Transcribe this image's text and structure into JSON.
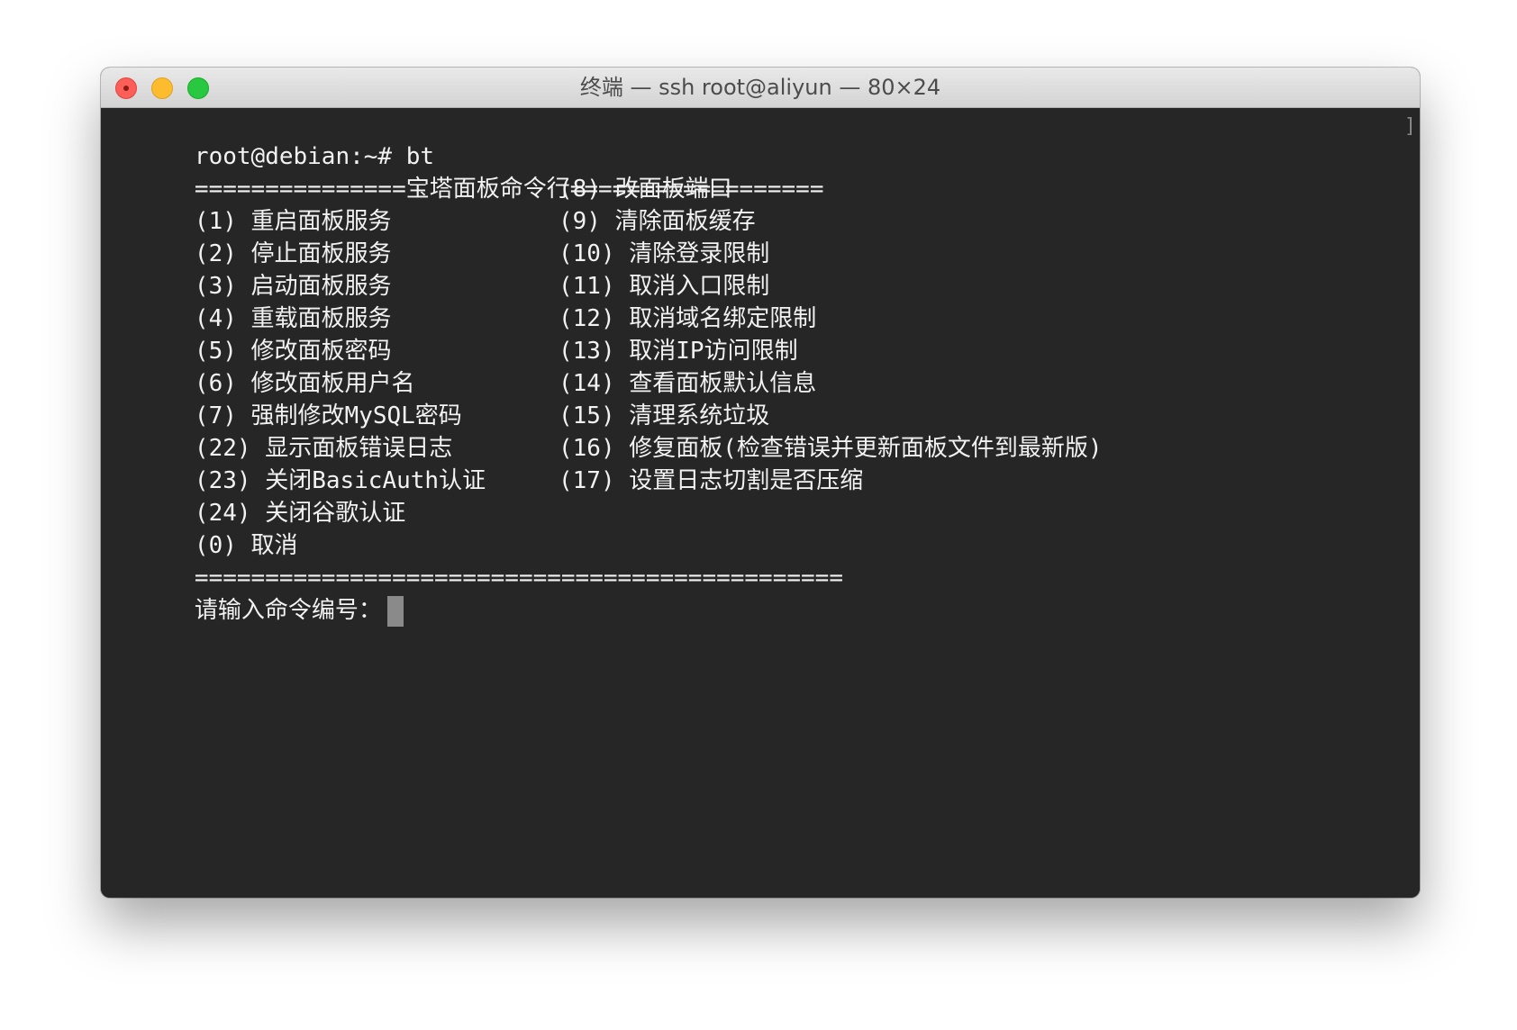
{
  "window": {
    "title": "终端 — ssh root@aliyun — 80×24"
  },
  "terminal": {
    "prompt": "root@debian:~# bt",
    "header": "===============宝塔面板命令行==================",
    "menu": [
      {
        "left": "(1) 重启面板服务",
        "right": "(8) 改面板端口"
      },
      {
        "left": "(2) 停止面板服务",
        "right": "(9) 清除面板缓存"
      },
      {
        "left": "(3) 启动面板服务",
        "right": "(10) 清除登录限制"
      },
      {
        "left": "(4) 重载面板服务",
        "right": "(11) 取消入口限制"
      },
      {
        "left": "(5) 修改面板密码",
        "right": "(12) 取消域名绑定限制"
      },
      {
        "left": "(6) 修改面板用户名",
        "right": "(13) 取消IP访问限制"
      },
      {
        "left": "(7) 强制修改MySQL密码",
        "right": "(14) 查看面板默认信息"
      },
      {
        "left": "(22) 显示面板错误日志",
        "right": "(15) 清理系统垃圾"
      },
      {
        "left": "(23) 关闭BasicAuth认证",
        "right": "(16) 修复面板(检查错误并更新面板文件到最新版)"
      },
      {
        "left": "(24) 关闭谷歌认证",
        "right": "(17) 设置日志切割是否压缩"
      },
      {
        "left": "(0) 取消",
        "right": ""
      }
    ],
    "footer": "==============================================",
    "input_prompt": "请输入命令编号："
  }
}
